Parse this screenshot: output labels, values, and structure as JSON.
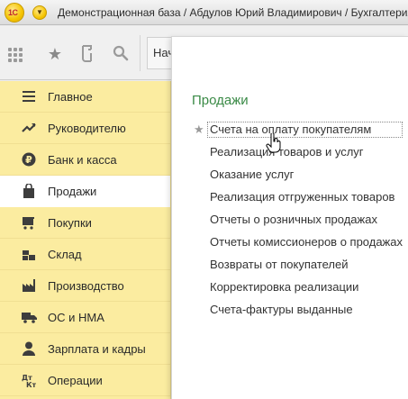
{
  "window": {
    "logo_text": "1C",
    "title": "Демонстрационная база / Абдулов Юрий Владимирович / Бухгалтерия предприятия"
  },
  "toolbar": {
    "start_tab_label": "Начальная страница",
    "icons": [
      "apps-grid-icon",
      "favorites-star-icon",
      "history-icon",
      "search-icon"
    ]
  },
  "sidebar": {
    "items": [
      {
        "label": "Главное",
        "icon": "menu-lines-icon",
        "active": false
      },
      {
        "label": "Руководителю",
        "icon": "trend-icon",
        "active": false
      },
      {
        "label": "Банк и касса",
        "icon": "ruble-coin-icon",
        "active": false
      },
      {
        "label": "Продажи",
        "icon": "shopping-bag-icon",
        "active": true
      },
      {
        "label": "Покупки",
        "icon": "cart-icon",
        "active": false
      },
      {
        "label": "Склад",
        "icon": "warehouse-icon",
        "active": false
      },
      {
        "label": "Производство",
        "icon": "factory-icon",
        "active": false
      },
      {
        "label": "ОС и НМА",
        "icon": "truck-icon",
        "active": false
      },
      {
        "label": "Зарплата и кадры",
        "icon": "person-icon",
        "active": false
      },
      {
        "label": "Операции",
        "icon": "dt-kt-icon",
        "active": false
      }
    ],
    "accent_color": "#fbeca0"
  },
  "panel": {
    "title": "Продажи",
    "title_color": "#3a8a46",
    "links": [
      "Счета на оплату покупателям",
      "Реализация товаров и услуг",
      "Оказание услуг",
      "Реализация отгруженных товаров",
      "Отчеты о розничных продажах",
      "Отчеты комиссионеров о продажах",
      "Возвраты от покупателей",
      "Корректировка реализации",
      "Счета-фактуры выданные"
    ]
  }
}
